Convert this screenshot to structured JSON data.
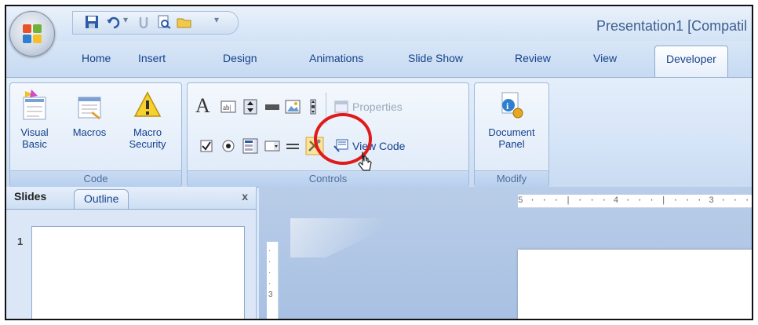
{
  "window": {
    "title": "Presentation1 [Compatil"
  },
  "tabs": [
    "Home",
    "Insert",
    "Design",
    "Animations",
    "Slide Show",
    "Review",
    "View",
    "Developer"
  ],
  "active_tab": "Developer",
  "ribbon": {
    "code_group": {
      "label": "Code",
      "visual_basic": "Visual\nBasic",
      "macros": "Macros",
      "macro_security": "Macro\nSecurity"
    },
    "controls_group": {
      "label": "Controls",
      "properties": "Properties",
      "view_code": "View Code"
    },
    "modify_group": {
      "label": "Modify",
      "document_panel": "Document\nPanel"
    }
  },
  "left_pane": {
    "tab_slides": "Slides",
    "tab_outline": "Outline",
    "close": "x",
    "slide_number": "1"
  },
  "ruler": {
    "top": "5 · · · | · · · 4 · · · | · · · 3 · · · | · · ·",
    "left_mark": "3"
  },
  "colors": {
    "accent": "#15428b",
    "highlight": "#e01a1a",
    "ribbon": "#dbe8f8"
  }
}
